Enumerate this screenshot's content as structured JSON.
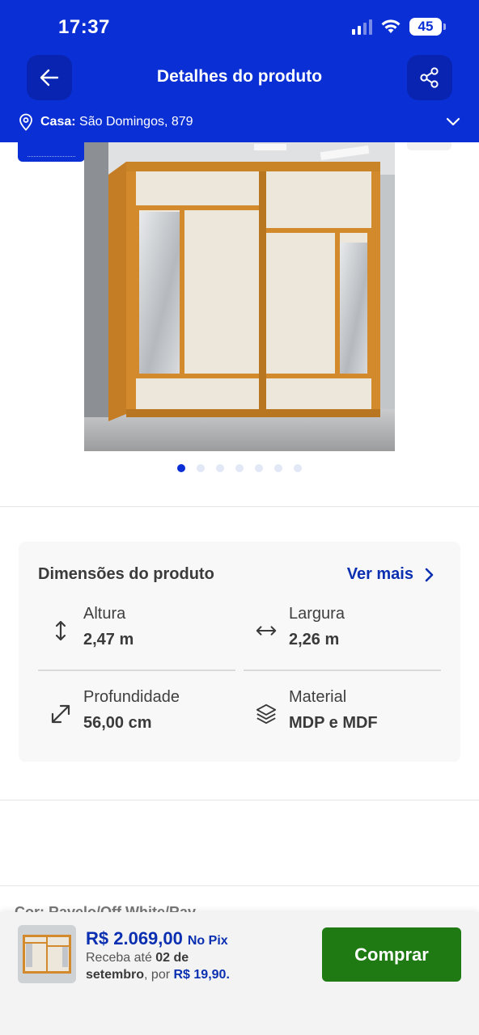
{
  "status_bar": {
    "time": "17:37",
    "battery": "45"
  },
  "header": {
    "title": "Detalhes do produto",
    "address_label": "Casa:",
    "address_value": " São Domingos, 879"
  },
  "gallery": {
    "total_images": 7,
    "active_index": 0
  },
  "dimensions": {
    "title": "Dimensões do produto",
    "see_more": "Ver mais",
    "items": [
      {
        "label": "Altura",
        "value": "2,47 m",
        "icon": "vertical-arrows-icon"
      },
      {
        "label": "Largura",
        "value": "2,26 m",
        "icon": "horizontal-arrows-icon"
      },
      {
        "label": "Profundidade",
        "value": "56,00 cm",
        "icon": "diagonal-arrows-icon"
      },
      {
        "label": "Material",
        "value": "MDP e MDF",
        "icon": "layers-icon"
      }
    ]
  },
  "partial_row": {
    "text": "Cor: Ravelo/Off White/Rav..."
  },
  "bottom_bar": {
    "price": "R$ 2.069,00",
    "payment_method": "No Pix",
    "delivery_prefix": "Receba até ",
    "delivery_date": "02 de setembro",
    "delivery_mid": ", por ",
    "shipping_price": "R$ 19,90.",
    "buy_label": "Comprar"
  },
  "colors": {
    "header_blue": "#0a2fd4",
    "link_blue": "#0a2fb0",
    "buy_green": "#1f7a14"
  }
}
